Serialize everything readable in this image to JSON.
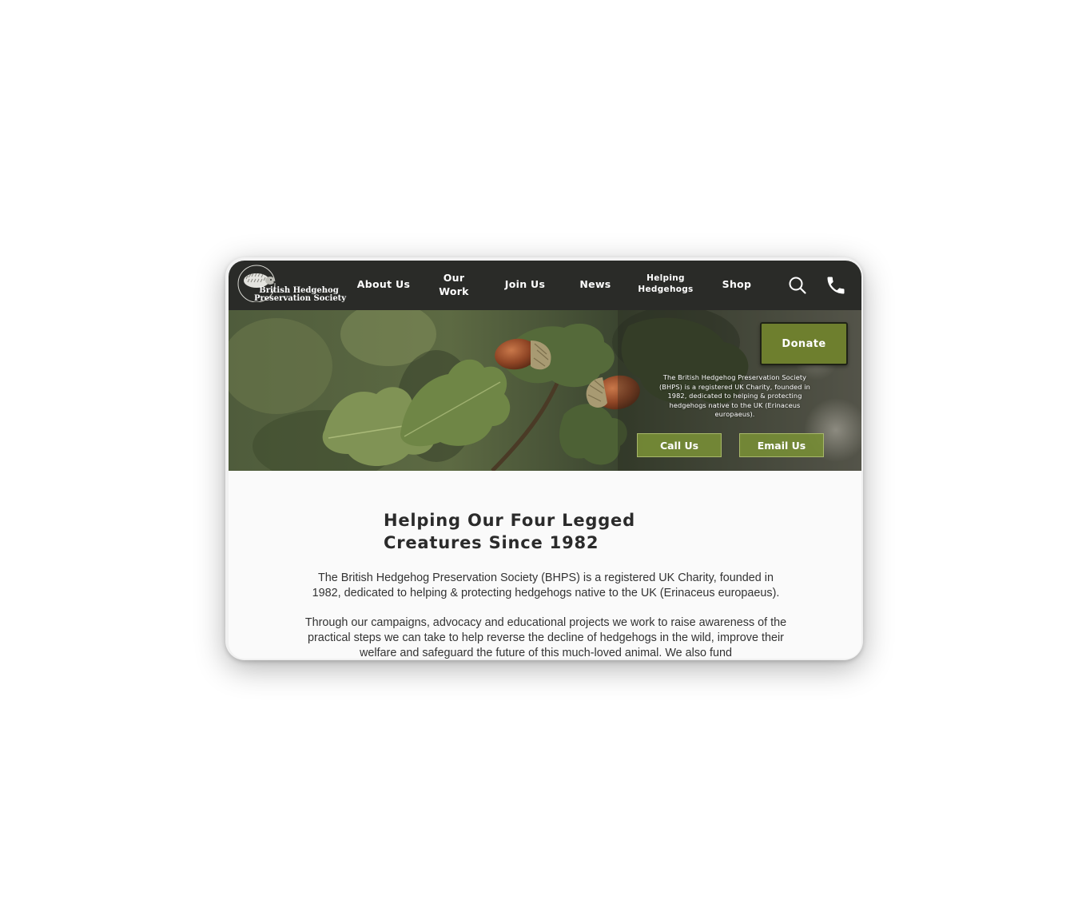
{
  "logo": {
    "line1": "British Hedgehog",
    "line2": "Preservation Society"
  },
  "nav": {
    "items": [
      {
        "label": "About Us"
      },
      {
        "label_line1": "Our",
        "label_line2": "Work"
      },
      {
        "label": "Join Us"
      },
      {
        "label": "News"
      },
      {
        "label_line1": "Helping",
        "label_line2": "Hedgehogs"
      },
      {
        "label": "Shop"
      }
    ],
    "icons": [
      "search-icon",
      "phone-icon"
    ]
  },
  "hero": {
    "donate_label": "Donate",
    "blurb": "The British Hedgehog Preservation Society (BHPS) is a registered UK Charity, founded in 1982, dedicated to helping & protecting hedgehogs native to the UK (Erinaceus europaeus).",
    "call_label": "Call Us",
    "email_label": "Email Us"
  },
  "main": {
    "title": "Helping Our Four Legged Creatures Since 1982",
    "paragraph1": "The British Hedgehog Preservation Society (BHPS) is a registered UK Charity, founded in 1982, dedicated to helping & protecting hedgehogs native to the UK (Erinaceus europaeus).",
    "paragraph2": "Through our campaigns, advocacy and educational projects we work to raise awareness of the practical steps we can take to help reverse the decline of hedgehogs in the wild, improve their welfare and safeguard the future of this much-loved animal. We also fund"
  },
  "colors": {
    "nav_bg": "#2a2b28",
    "accent_green": "#6e7f2e",
    "hero_button_green": "#768c36",
    "heading_text": "#2b2b2b"
  }
}
